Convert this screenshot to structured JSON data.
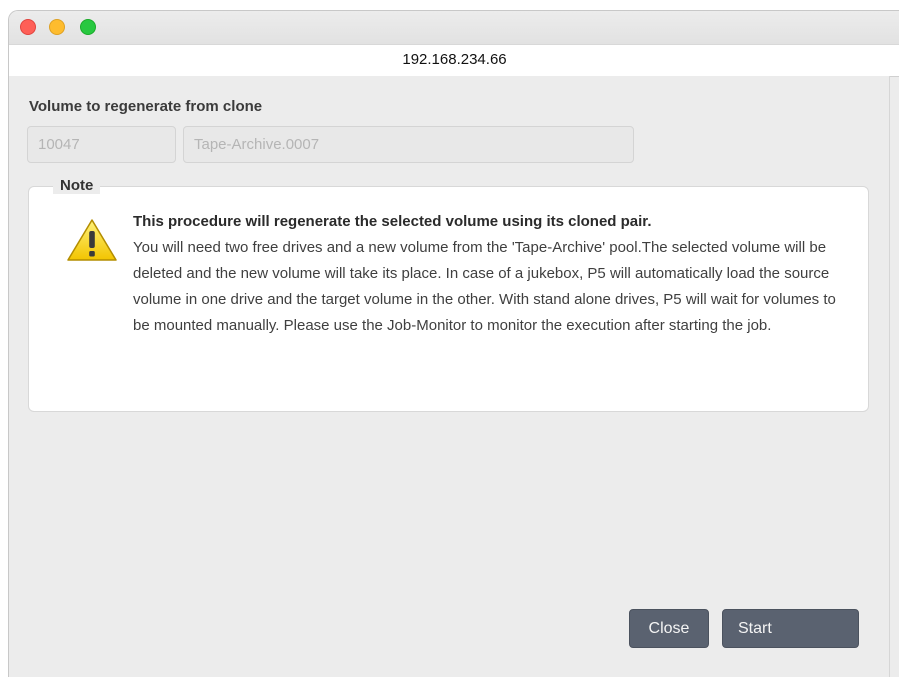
{
  "window": {
    "address": "192.168.234.66"
  },
  "form": {
    "section_label": "Volume to regenerate from clone",
    "volume_id": "10047",
    "volume_label": "Tape-Archive.0007"
  },
  "note": {
    "legend": "Note",
    "icon": "warning-icon",
    "heading": "This procedure will regenerate the selected volume using its cloned pair.",
    "body": "You will need two free drives and a new volume from the 'Tape-Archive' pool.The selected volume will be deleted and the new volume will take its place. In case of a jukebox, P5 will automatically load the source volume in one drive and the target volume in the other. With stand alone drives, P5 will wait for volumes to be mounted manually. Please use the Job-Monitor to monitor the execution after starting the job."
  },
  "buttons": {
    "close_label": "Close",
    "start_label": "Start"
  },
  "colors": {
    "button_bg": "#5a6270",
    "warning_yellow": "#f5d000"
  }
}
